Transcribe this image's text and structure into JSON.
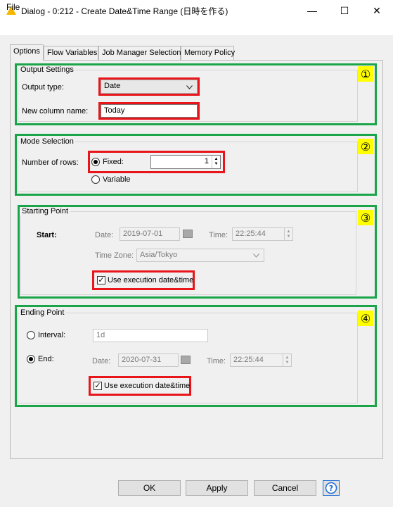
{
  "window": {
    "title": "Dialog - 0:212 - Create Date&Time Range (日時を作る)",
    "minimize_glyph": "—",
    "maximize_glyph": "☐",
    "close_glyph": "✕"
  },
  "menu": {
    "file": "File"
  },
  "tabs": [
    {
      "label": "Options",
      "active": true
    },
    {
      "label": "Flow Variables"
    },
    {
      "label": "Job Manager Selection"
    },
    {
      "label": "Memory Policy"
    }
  ],
  "output_settings": {
    "legend": "Output Settings",
    "badge": "①",
    "output_type_label": "Output type:",
    "output_type_value": "Date",
    "new_column_label": "New column name:",
    "new_column_value": "Today"
  },
  "mode_selection": {
    "legend": "Mode Selection",
    "badge": "②",
    "rows_label": "Number of rows:",
    "fixed_label": "Fixed:",
    "fixed_value": "1",
    "variable_label": "Variable"
  },
  "starting_point": {
    "legend": "Starting Point",
    "badge": "③",
    "start_label": "Start:",
    "date_label": "Date:",
    "date_value": "2019-07-01",
    "time_label": "Time:",
    "time_value": "22:25:44",
    "timezone_label": "Time Zone:",
    "timezone_value": "Asia/Tokyo",
    "use_exec_label": "Use execution date&time",
    "use_exec_checked": true
  },
  "ending_point": {
    "legend": "Ending Point",
    "badge": "④",
    "interval_label": "Interval:",
    "interval_value": "1d",
    "end_label": "End:",
    "date_label": "Date:",
    "date_value": "2020-07-31",
    "time_label": "Time:",
    "time_value": "22:25:44",
    "use_exec_label": "Use execution date&time",
    "use_exec_checked": true
  },
  "footer": {
    "ok": "OK",
    "apply": "Apply",
    "cancel": "Cancel",
    "help_glyph": "?"
  },
  "colors": {
    "green_highlight": "#1aa54a",
    "red_highlight": "#e8161b",
    "badge_yellow": "#ffff00",
    "help_blue": "#1c6cd8"
  }
}
